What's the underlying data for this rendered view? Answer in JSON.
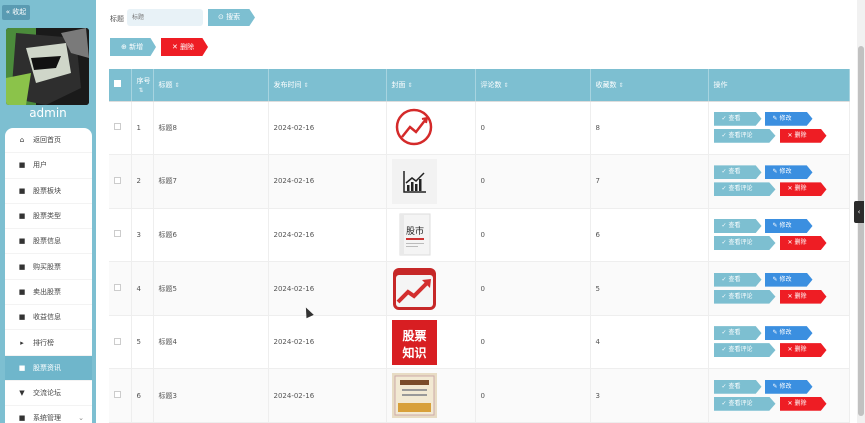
{
  "sidebar": {
    "collapse_label": "« 收起",
    "username": "admin",
    "menu": [
      {
        "label": "返回首页",
        "icon": "⌂"
      },
      {
        "label": "用户",
        "icon": "■"
      },
      {
        "label": "股票板块",
        "icon": "■"
      },
      {
        "label": "股票类型",
        "icon": "■"
      },
      {
        "label": "股票信息",
        "icon": "■"
      },
      {
        "label": "购买股票",
        "icon": "■"
      },
      {
        "label": "卖出股票",
        "icon": "■"
      },
      {
        "label": "收益信息",
        "icon": "■"
      },
      {
        "label": "排行榜",
        "icon": "▸"
      },
      {
        "label": "股票资讯",
        "icon": "■"
      },
      {
        "label": "交流论坛",
        "icon": "▼"
      },
      {
        "label": "系统管理",
        "icon": "■"
      }
    ],
    "active_index": 9
  },
  "search": {
    "label": "标题",
    "placeholder": "标题",
    "button": "搜索"
  },
  "toolbar": {
    "add": "新增",
    "delete": "删除"
  },
  "table": {
    "headers": [
      "",
      "序号",
      "标题",
      "发布时间",
      "封面",
      "评论数",
      "收藏数",
      "操作"
    ],
    "rows": [
      {
        "index": "1",
        "title": "标题8",
        "date": "2024-02-16",
        "cover": "red-circle-chart",
        "comments": "0",
        "favorites": "8"
      },
      {
        "index": "2",
        "title": "标题7",
        "date": "2024-02-16",
        "cover": "line-chart-icon",
        "comments": "0",
        "favorites": "7"
      },
      {
        "index": "3",
        "title": "标题6",
        "date": "2024-02-16",
        "cover": "book-gushi",
        "comments": "0",
        "favorites": "6"
      },
      {
        "index": "4",
        "title": "标题5",
        "date": "2024-02-16",
        "cover": "calendar-arrow",
        "comments": "0",
        "favorites": "5"
      },
      {
        "index": "5",
        "title": "标题4",
        "date": "2024-02-16",
        "cover": "gupiao-zhishi",
        "comments": "0",
        "favorites": "4"
      },
      {
        "index": "6",
        "title": "标题3",
        "date": "2024-02-16",
        "cover": "book-cover",
        "comments": "0",
        "favorites": "3"
      }
    ],
    "ops": {
      "view": "查看",
      "edit": "修改",
      "comment": "查看评论",
      "delete": "删除"
    }
  },
  "cover_texts": {
    "book_title": "股市",
    "poster_line1": "股票",
    "poster_line2": "知识"
  },
  "colors": {
    "accent": "#7dbfd1",
    "danger": "#ee1d24",
    "primary": "#3b8fe0"
  }
}
